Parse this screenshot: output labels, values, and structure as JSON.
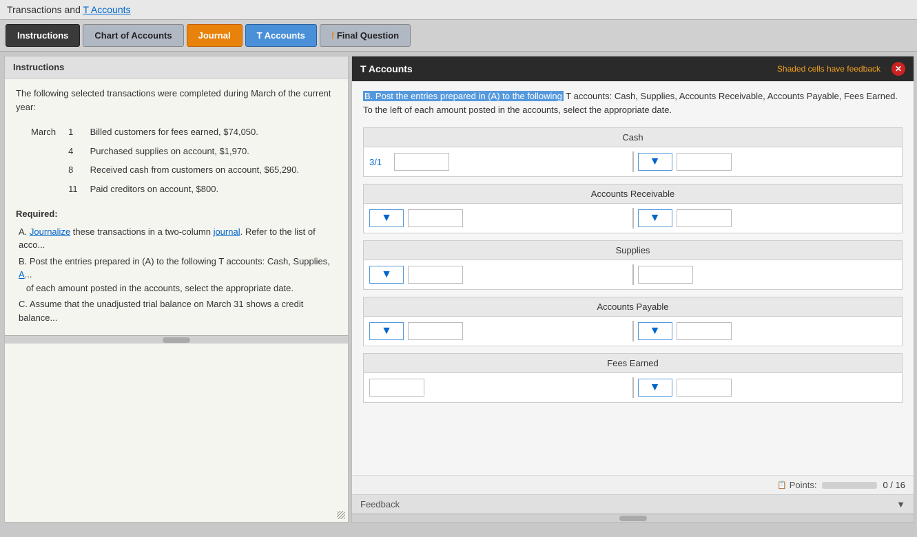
{
  "topbar": {
    "title": "Transactions and ",
    "link_text": "T Accounts"
  },
  "tabs": [
    {
      "id": "instructions",
      "label": "Instructions",
      "style": "active-dark"
    },
    {
      "id": "chart-of-accounts",
      "label": "Chart of Accounts",
      "style": "normal"
    },
    {
      "id": "journal",
      "label": "Journal",
      "style": "active-orange"
    },
    {
      "id": "t-accounts",
      "label": "T Accounts",
      "style": "active-blue"
    },
    {
      "id": "final-question",
      "label": "Final Question",
      "style": "warning"
    }
  ],
  "left_panel": {
    "header": "Instructions",
    "intro": "The following selected transactions were completed during March of the current year:",
    "transactions": [
      {
        "month": "March",
        "day": "1",
        "description": "Billed customers for fees earned, $74,050."
      },
      {
        "day": "4",
        "description": "Purchased supplies on account, $1,970."
      },
      {
        "day": "8",
        "description": "Received cash from customers on account, $65,290."
      },
      {
        "day": "11",
        "description": "Paid creditors on account, $800."
      }
    ],
    "required_label": "Required:",
    "requirements": [
      {
        "letter": "A.",
        "text": "Journalize these transactions in a two-column journal. Refer to the list of acco..."
      },
      {
        "letter": "B.",
        "text": "Post the entries prepared in (A) to the following T accounts: Cash, Supplies, A... of each amount posted in the accounts, select the appropriate date."
      },
      {
        "letter": "C.",
        "text": "Assume that the unadjusted trial balance on March 31 shows a credit balance..."
      }
    ]
  },
  "right_panel": {
    "header": "T Accounts",
    "feedback_notice": "Shaded cells have feedback",
    "instruction_highlight": "B. Post the entries prepared in (A) to the following",
    "instruction_rest": " T accounts: Cash, Supplies, Accounts Receivable, Accounts Payable, Fees Earned. To the left of each amount posted in the accounts, select the appropriate date.",
    "accounts": [
      {
        "id": "cash",
        "name": "Cash",
        "rows": [
          {
            "left": {
              "date_label": "3/1",
              "has_dropdown": false,
              "input_val": ""
            },
            "right": {
              "has_dropdown": true,
              "input_val": ""
            }
          }
        ]
      },
      {
        "id": "accounts-receivable",
        "name": "Accounts Receivable",
        "rows": [
          {
            "left": {
              "date_label": "",
              "has_dropdown": true,
              "input_val": ""
            },
            "right": {
              "has_dropdown": true,
              "input_val": ""
            }
          }
        ]
      },
      {
        "id": "supplies",
        "name": "Supplies",
        "rows": [
          {
            "left": {
              "date_label": "",
              "has_dropdown": true,
              "input_val": ""
            },
            "right": {
              "has_dropdown": false,
              "input_val": ""
            }
          }
        ]
      },
      {
        "id": "accounts-payable",
        "name": "Accounts Payable",
        "rows": [
          {
            "left": {
              "date_label": "",
              "has_dropdown": true,
              "input_val": ""
            },
            "right": {
              "has_dropdown": true,
              "input_val": ""
            }
          }
        ]
      },
      {
        "id": "fees-earned",
        "name": "Fees Earned",
        "rows": [
          {
            "left": {
              "date_label": "",
              "has_dropdown": false,
              "input_val": ""
            },
            "right": {
              "has_dropdown": true,
              "input_val": ""
            }
          }
        ]
      }
    ],
    "points": {
      "label": "Points:",
      "current": 0,
      "total": 16,
      "display": "0 / 16"
    },
    "feedback_label": "Feedback"
  }
}
